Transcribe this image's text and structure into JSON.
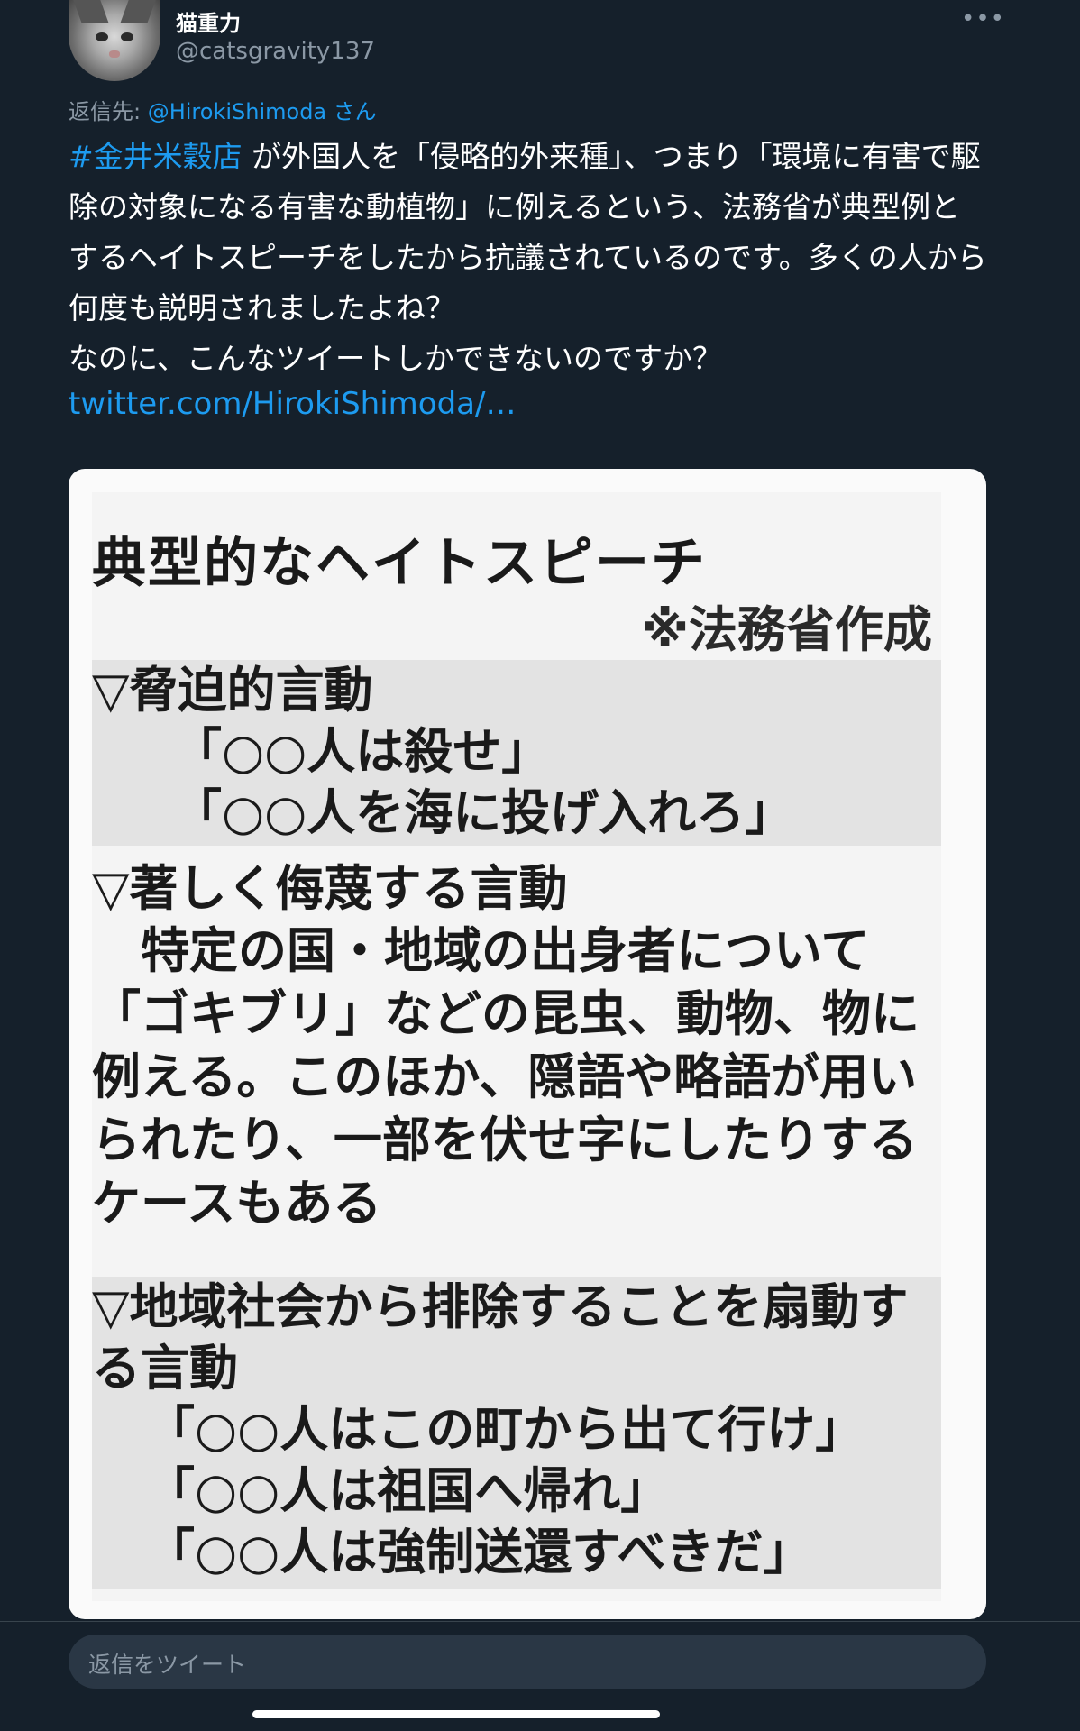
{
  "author": {
    "display_name": "猫重力",
    "handle": "@catsgravity137",
    "more_icon": "more-icon"
  },
  "reply_to": {
    "prefix": "返信先: ",
    "mention": "@HirokiShimoda",
    "suffix": " さん"
  },
  "tweet": {
    "hashtag": "#金井米穀店",
    "body": " が外国人を「侵略的外来種」、つまり「環境に有害で駆除の対象になる有害な動植物」に例えるという、法務省が典型例とするヘイトスピーチをしたから抗議されているのです。多くの人から何度も説明されましたよね？\nなのに、こんなツイートしかできないのですか？",
    "link": "twitter.com/HirokiShimoda/…"
  },
  "image": {
    "title": "典型的なヘイトスピーチ",
    "note": "※法務省作成",
    "section1": {
      "heading": "▽脅迫的言動",
      "lines": [
        "「○○人は殺せ」",
        "「○○人を海に投げ入れろ」"
      ]
    },
    "section2": {
      "heading": "▽著しく侮蔑する言動",
      "body": "　特定の国・地域の出身者について「ゴキブリ」などの昆虫、動物、物に例える。このほか、隠語や略語が用いられたり、一部を伏せ字にしたりするケースもある"
    },
    "section3": {
      "heading": "▽地域社会から排除することを扇動する言動",
      "lines": [
        "「○○人はこの町から出て行け」",
        "「○○人は祖国へ帰れ」",
        "「○○人は強制送還すべきだ」"
      ]
    }
  },
  "reply_bar": {
    "placeholder": "返信をツイート"
  }
}
